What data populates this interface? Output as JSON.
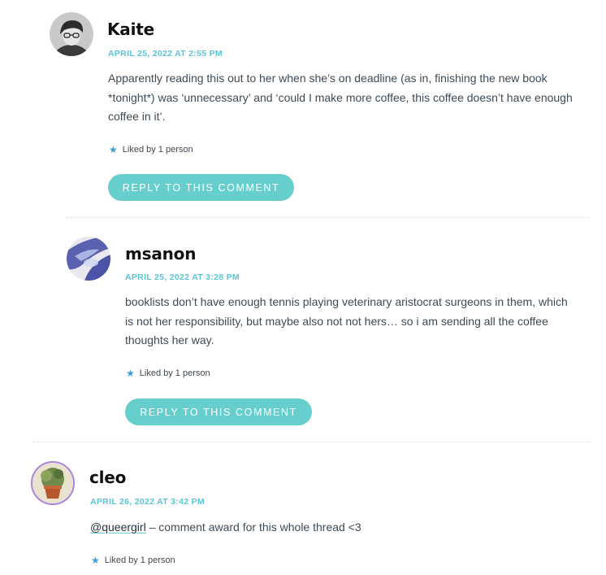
{
  "comments": [
    {
      "author": "Kaite",
      "date": "APRIL 25, 2022 AT 2:55 PM",
      "lines": [
        "Apparently reading this out to her when she’s on deadline (as in, finishing the new book",
        "*tonight*) was ‘unnecessary’ and ‘could I make more coffee, this coffee doesn’t have enough",
        "coffee in it’."
      ],
      "likes": "Liked by 1 person",
      "reply_label": "REPLY TO THIS COMMENT"
    },
    {
      "author": "msanon",
      "date": "APRIL 25, 2022 AT 3:28 PM",
      "lines": [
        "booklists don’t have enough tennis playing veterinary aristocrat surgeons in them, which",
        "is not her responsibility, but maybe also not not hers… so i am sending all the coffee",
        "thoughts her way."
      ],
      "likes": "Liked by 1 person",
      "reply_label": "REPLY TO THIS COMMENT"
    },
    {
      "author": "cleo",
      "date": "APRIL 26, 2022 AT 3:42 PM",
      "mention": "@queergirl",
      "text": " – comment award for this whole thread <3",
      "likes": "Liked by 1 person"
    }
  ],
  "icons": {
    "like": "star-icon"
  },
  "colors": {
    "accent": "#66cfcd",
    "date": "#5bc5d3",
    "star": "#3b9fd6"
  }
}
